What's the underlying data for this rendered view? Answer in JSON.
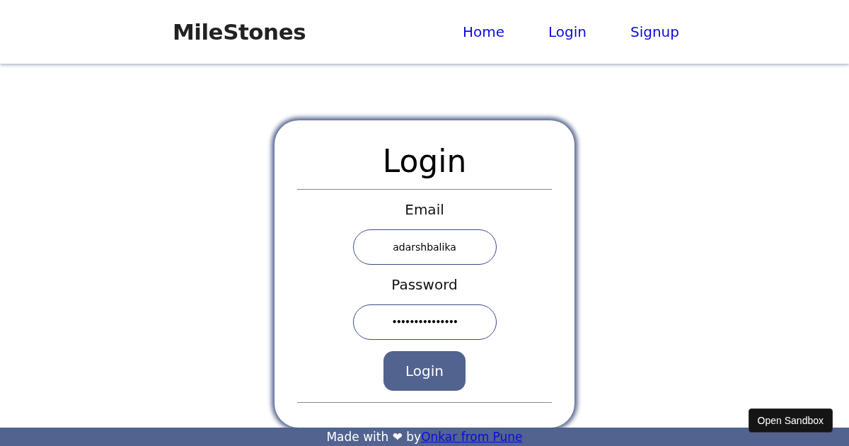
{
  "header": {
    "logo": "MileStones",
    "nav": [
      {
        "label": "Home"
      },
      {
        "label": "Login"
      },
      {
        "label": "Signup"
      }
    ]
  },
  "card": {
    "title": "Login",
    "fields": [
      {
        "label": "Email",
        "value": "adarshbalika",
        "kind": "text"
      },
      {
        "label": "Password",
        "value": "•••••••••••••••",
        "kind": "password"
      }
    ],
    "button": "Login"
  },
  "footer": {
    "text": "Made with ❤ by",
    "link": "Onkar from Pune"
  },
  "sandbox_button": "Open Sandbox"
}
